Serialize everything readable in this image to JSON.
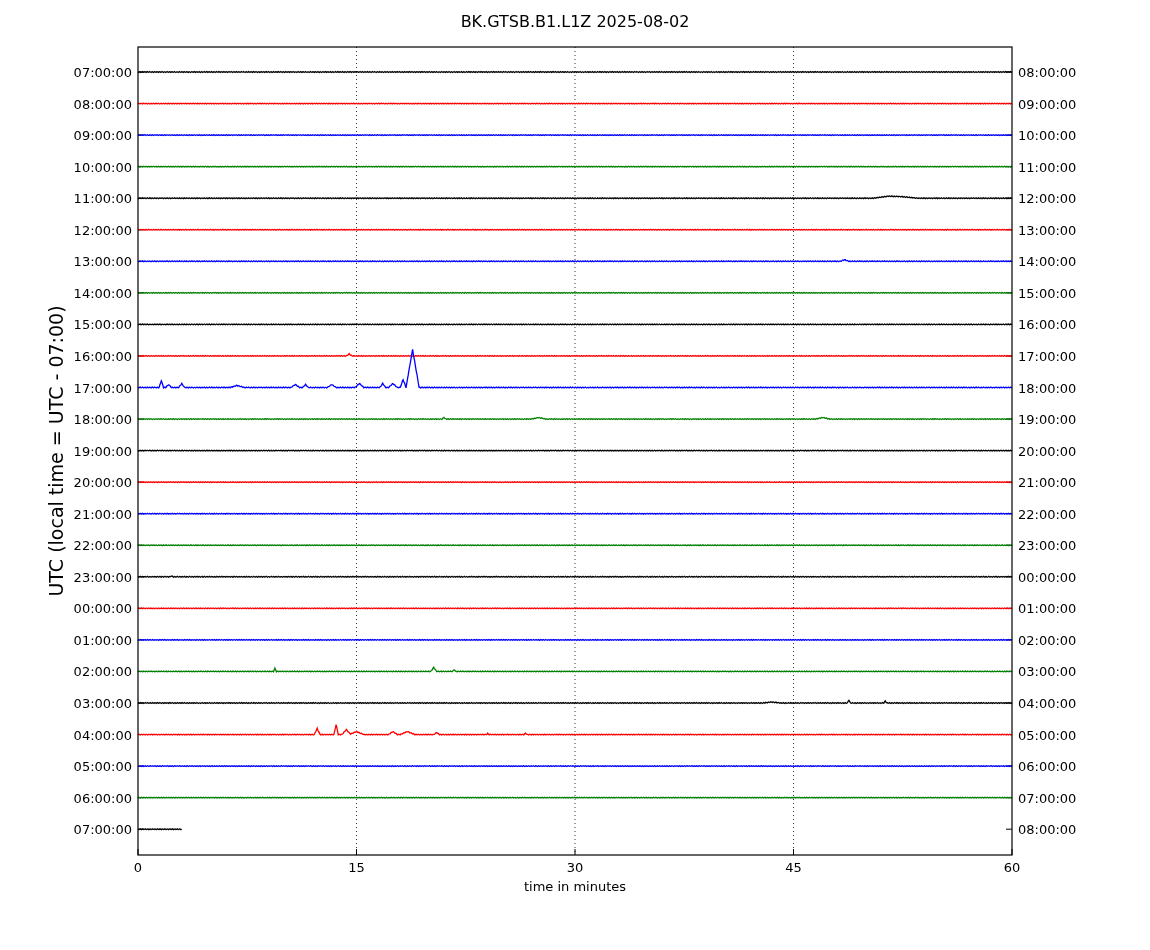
{
  "title": "BK.GTSB.B1.L1Z 2025-08-02",
  "ylabel": "UTC (local time = UTC - 07:00)",
  "xlabel": "time in minutes",
  "xticks": [
    "0",
    "15",
    "30",
    "45",
    "60"
  ],
  "traces": [
    {
      "left_label": "07:00:00",
      "right_label": "08:00:00",
      "color": "#000000"
    },
    {
      "left_label": "08:00:00",
      "right_label": "09:00:00",
      "color": "#ff0000"
    },
    {
      "left_label": "09:00:00",
      "right_label": "10:00:00",
      "color": "#0000ff"
    },
    {
      "left_label": "10:00:00",
      "right_label": "11:00:00",
      "color": "#008000"
    },
    {
      "left_label": "11:00:00",
      "right_label": "12:00:00",
      "color": "#000000"
    },
    {
      "left_label": "12:00:00",
      "right_label": "13:00:00",
      "color": "#ff0000"
    },
    {
      "left_label": "13:00:00",
      "right_label": "14:00:00",
      "color": "#0000ff"
    },
    {
      "left_label": "14:00:00",
      "right_label": "15:00:00",
      "color": "#008000"
    },
    {
      "left_label": "15:00:00",
      "right_label": "16:00:00",
      "color": "#000000"
    },
    {
      "left_label": "16:00:00",
      "right_label": "17:00:00",
      "color": "#ff0000"
    },
    {
      "left_label": "17:00:00",
      "right_label": "18:00:00",
      "color": "#0000ff"
    },
    {
      "left_label": "18:00:00",
      "right_label": "19:00:00",
      "color": "#008000"
    },
    {
      "left_label": "19:00:00",
      "right_label": "20:00:00",
      "color": "#000000"
    },
    {
      "left_label": "20:00:00",
      "right_label": "21:00:00",
      "color": "#ff0000"
    },
    {
      "left_label": "21:00:00",
      "right_label": "22:00:00",
      "color": "#0000ff"
    },
    {
      "left_label": "22:00:00",
      "right_label": "23:00:00",
      "color": "#008000"
    },
    {
      "left_label": "23:00:00",
      "right_label": "00:00:00",
      "color": "#000000"
    },
    {
      "left_label": "00:00:00",
      "right_label": "01:00:00",
      "color": "#ff0000"
    },
    {
      "left_label": "01:00:00",
      "right_label": "02:00:00",
      "color": "#0000ff"
    },
    {
      "left_label": "02:00:00",
      "right_label": "03:00:00",
      "color": "#008000"
    },
    {
      "left_label": "03:00:00",
      "right_label": "04:00:00",
      "color": "#000000"
    },
    {
      "left_label": "04:00:00",
      "right_label": "05:00:00",
      "color": "#ff0000"
    },
    {
      "left_label": "05:00:00",
      "right_label": "06:00:00",
      "color": "#0000ff"
    },
    {
      "left_label": "06:00:00",
      "right_label": "07:00:00",
      "color": "#008000"
    },
    {
      "left_label": "07:00:00",
      "right_label": "08:00:00",
      "color": "#000000"
    }
  ]
}
